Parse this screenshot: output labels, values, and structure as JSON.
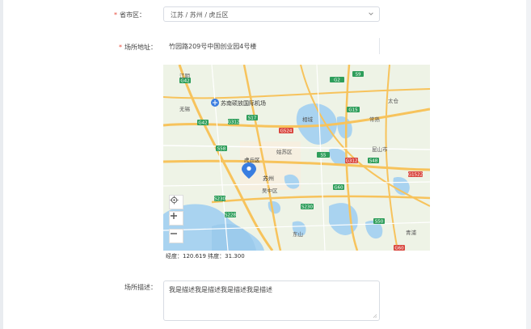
{
  "form": {
    "region": {
      "required_mark": "*",
      "label": "省市区：",
      "value": "江苏 / 苏州 / 虎丘区"
    },
    "address": {
      "required_mark": "*",
      "label": "场所地址：",
      "value": "竹园路209号中国创业园4号楼"
    },
    "map": {
      "coords_text": "经度：120.619  纬度：31.300",
      "labels": {
        "airport": "苏南硕放国际机场",
        "suzhou": "苏州",
        "huqiu": "虎丘区",
        "wuxi_area": "无锡",
        "kunshan": "昆山市",
        "taicang": "太仓",
        "gusu": "姑苏区",
        "wuzhong": "吴中区",
        "xiangcheng": "相城",
        "jiangyin": "江阴",
        "changshu": "常熟",
        "dongshan": "东山",
        "qingpu": "青浦"
      },
      "roads": {
        "g2": "G2",
        "s9": "S9",
        "g42": "G42",
        "g524": "G524",
        "s17": "S17",
        "g312": "G312",
        "s58": "S58",
        "s230": "S230",
        "g15": "G15",
        "s48": "S48",
        "s5": "S5",
        "g60": "G60",
        "s228": "S228",
        "s50": "S50",
        "g1522": "G1522"
      },
      "colors": {
        "water": "#a9d3f0",
        "land": "#eef3e6",
        "highway": "#f7c35c",
        "road": "#ffffff",
        "green_badge": "#2e9e5b",
        "red_badge": "#d9463e",
        "marker": "#3a7de0"
      }
    },
    "description": {
      "label": "场所描述：",
      "value": "我是描述我是描述我是描述我是描述"
    }
  }
}
